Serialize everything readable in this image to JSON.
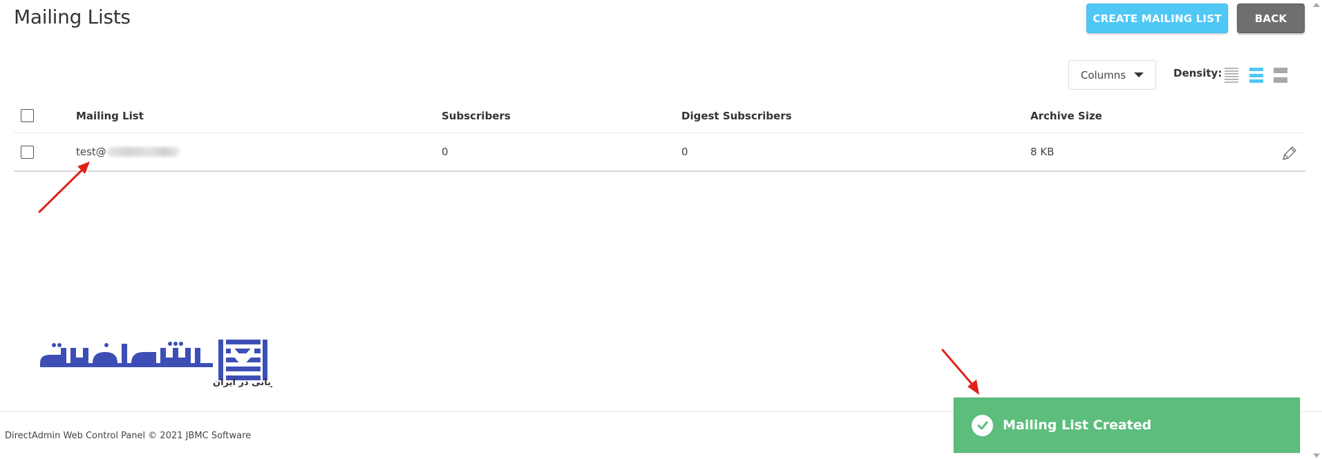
{
  "header": {
    "title": "Mailing Lists",
    "create_label": "CREATE MAILING LIST",
    "back_label": "BACK"
  },
  "toolbar": {
    "columns_label": "Columns",
    "density_label": "Density:",
    "density_selected": "medium"
  },
  "table": {
    "headers": [
      "Mailing List",
      "Subscribers",
      "Digest Subscribers",
      "Archive Size"
    ],
    "rows": [
      {
        "name_prefix": "test@",
        "subscribers": "0",
        "digest_subscribers": "0",
        "archive_size": "8 KB"
      }
    ]
  },
  "footer": {
    "text": "DirectAdmin Web Control Panel © 2021 JBMC Software"
  },
  "notification": {
    "message": "Mailing List Created",
    "color": "#5cbd7c"
  },
  "logo": {
    "brand": "مشهدهاست",
    "tagline": "متنوع ترین خدمات میزبانی در ایران"
  },
  "colors": {
    "accent": "#4fc8f5",
    "back_button": "#6f6f6f",
    "annotation_arrow": "#e0201a"
  }
}
